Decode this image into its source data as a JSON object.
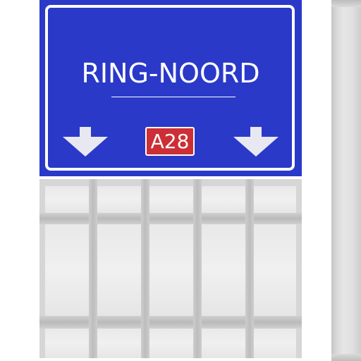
{
  "sign": {
    "title": "RING-NOORD",
    "road_number": "A28",
    "background_color": "#2a39c8",
    "badge_color": "#cc2f35",
    "left_arrow_icon": "arrow-down-icon",
    "right_arrow_icon": "arrow-down-icon"
  },
  "structure": {
    "color": "#d6d6d6"
  },
  "post": {
    "color": "#dcdcdc"
  }
}
